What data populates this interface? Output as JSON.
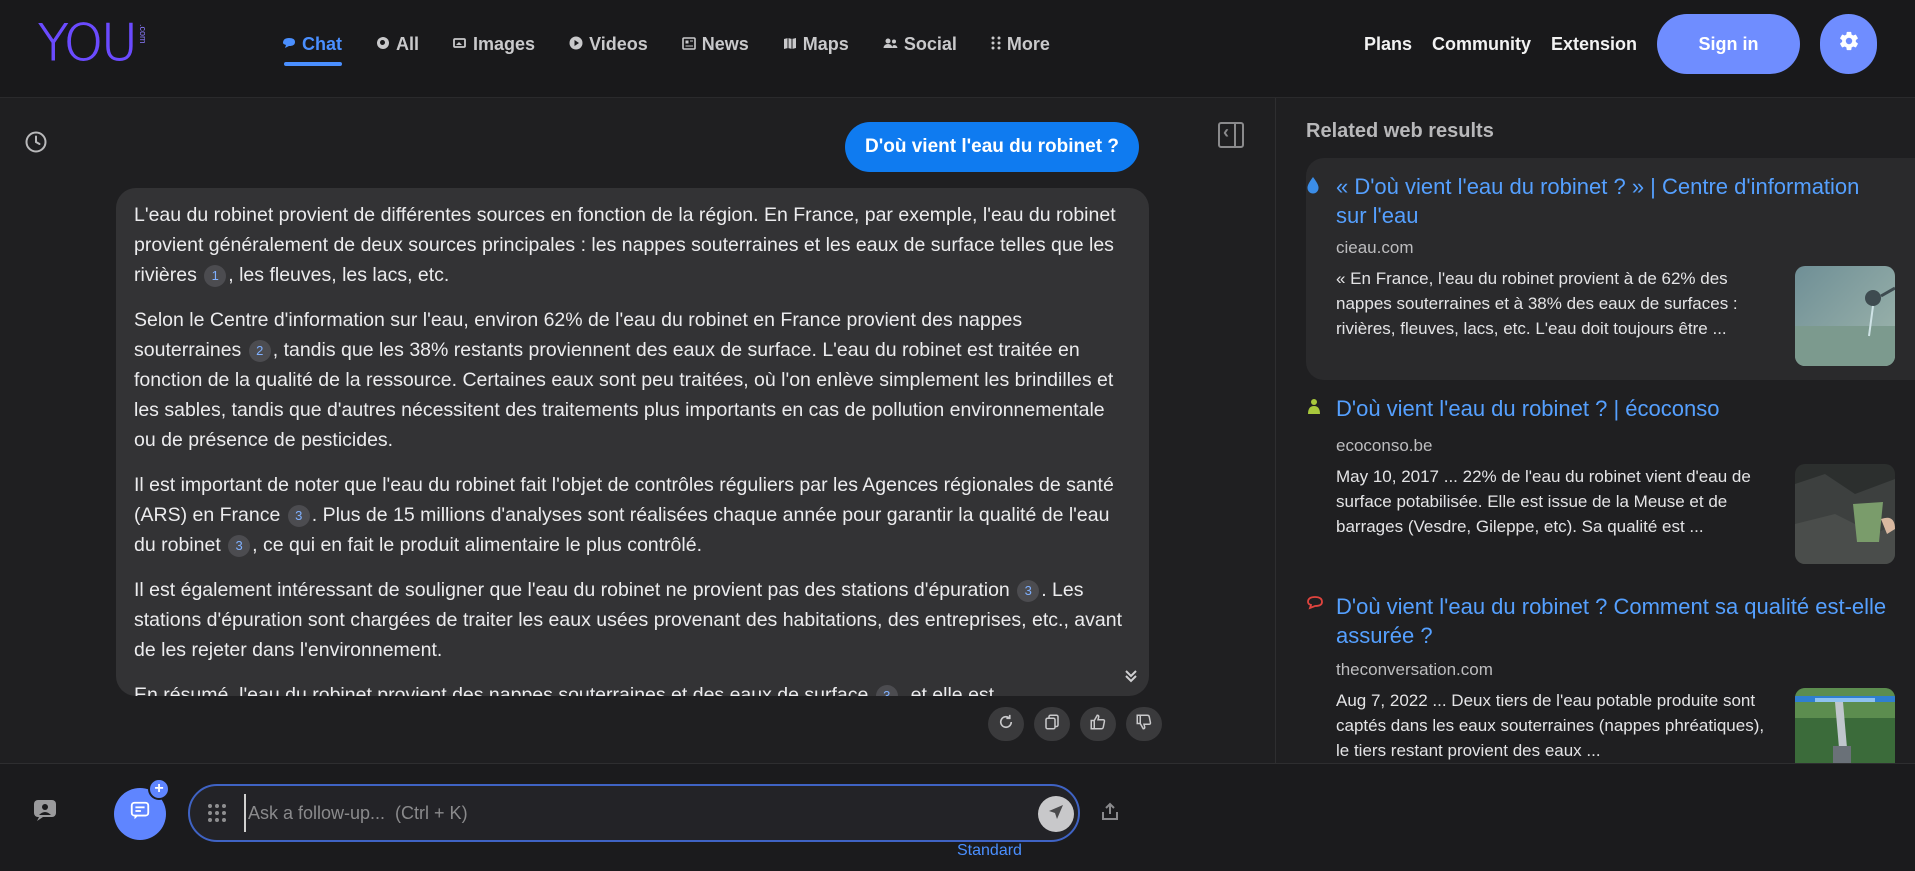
{
  "header": {
    "logo_text": "YOU",
    "logo_suffix": ".com",
    "nav": [
      {
        "label": "Chat",
        "icon": "chat-icon",
        "active": true
      },
      {
        "label": "All",
        "icon": "search-icon",
        "active": false
      },
      {
        "label": "Images",
        "icon": "images-icon",
        "active": false
      },
      {
        "label": "Videos",
        "icon": "play-icon",
        "active": false
      },
      {
        "label": "News",
        "icon": "newspaper-icon",
        "active": false
      },
      {
        "label": "Maps",
        "icon": "map-icon",
        "active": false
      },
      {
        "label": "Social",
        "icon": "people-icon",
        "active": false
      },
      {
        "label": "More",
        "icon": "dots-grid-icon",
        "active": false
      }
    ],
    "links": {
      "plans": "Plans",
      "community": "Community",
      "extension": "Extension"
    },
    "sign_in": "Sign in",
    "accent_color": "#6f8dff"
  },
  "chat": {
    "user_message": "D'où vient l'eau du robinet ?",
    "answer": {
      "p1": {
        "a": "L'eau du robinet provient de différentes sources en fonction de la région. En France, par exemple, l'eau du robinet provient généralement de deux sources principales : les nappes souterraines et les eaux de surface telles que les rivières",
        "c1": "1",
        "b": ", les fleuves, les lacs, etc."
      },
      "p2": {
        "a": "Selon le Centre d'information sur l'eau, environ 62% de l'eau du robinet en France provient des nappes souterraines",
        "c1": "2",
        "b": ", tandis que les 38% restants proviennent des eaux de surface. L'eau du robinet est traitée en fonction de la qualité de la ressource. Certaines eaux sont peu traitées, où l'on enlève simplement les brindilles et les sables, tandis que d'autres nécessitent des traitements plus importants en cas de pollution environnementale ou de présence de pesticides."
      },
      "p3": {
        "a": "Il est important de noter que l'eau du robinet fait l'objet de contrôles réguliers par les Agences régionales de santé (ARS) en France",
        "c1": "3",
        "b": ". Plus de 15 millions d'analyses sont réalisées chaque année pour garantir la qualité de l'eau du robinet",
        "c2": "3",
        "c": ", ce qui en fait le produit alimentaire le plus contrôlé."
      },
      "p4": {
        "a": "Il est également intéressant de souligner que l'eau du robinet ne provient pas des stations d'épuration",
        "c1": "3",
        "b": ". Les stations d'épuration sont chargées de traiter les eaux usées provenant des habitations, des entreprises, etc., avant de les rejeter dans l'environnement."
      },
      "p5": {
        "a": "En résumé, l'eau du robinet provient des nappes souterraines et des eaux de surface",
        "c1": "3",
        "b": ", et elle est"
      }
    },
    "actions": [
      "refresh-icon",
      "copy-icon",
      "thumbs-up-icon",
      "thumbs-down-icon"
    ]
  },
  "related": {
    "title": "Related web results",
    "results": [
      {
        "title": "« D'où vient l'eau du robinet ? » | Centre d'information sur l'eau",
        "domain": "cieau.com",
        "snippet": "« En France, l'eau du robinet provient à de 62% des nappes souterraines et à 38% des eaux de surfaces : rivières, fleuves, lacs, etc. L'eau doit toujours être ...",
        "icon": "water-drop-icon"
      },
      {
        "title": "D'où vient l'eau du robinet ? | écoconso",
        "domain": "ecoconso.be",
        "snippet": "May 10, 2017 ... 22% de l'eau du robinet vient d'eau de surface potabilisée. Elle est issue de la Meuse et de barrages (Vesdre, Gileppe, etc). Sa qualité est ...",
        "icon": "leaf-icon"
      },
      {
        "title": "D'où vient l'eau du robinet ? Comment sa qualité est-elle assurée ?",
        "domain": "theconversation.com",
        "snippet": "Aug 7, 2022 ... Deux tiers de l'eau potable produite sont captés dans les eaux souterraines (nappes phréatiques), le tiers restant provient des eaux ...",
        "icon": "speech-bubble-icon"
      }
    ]
  },
  "composer": {
    "placeholder": "Ask a follow-up...  (Ctrl + K)",
    "mode": "Standard"
  }
}
